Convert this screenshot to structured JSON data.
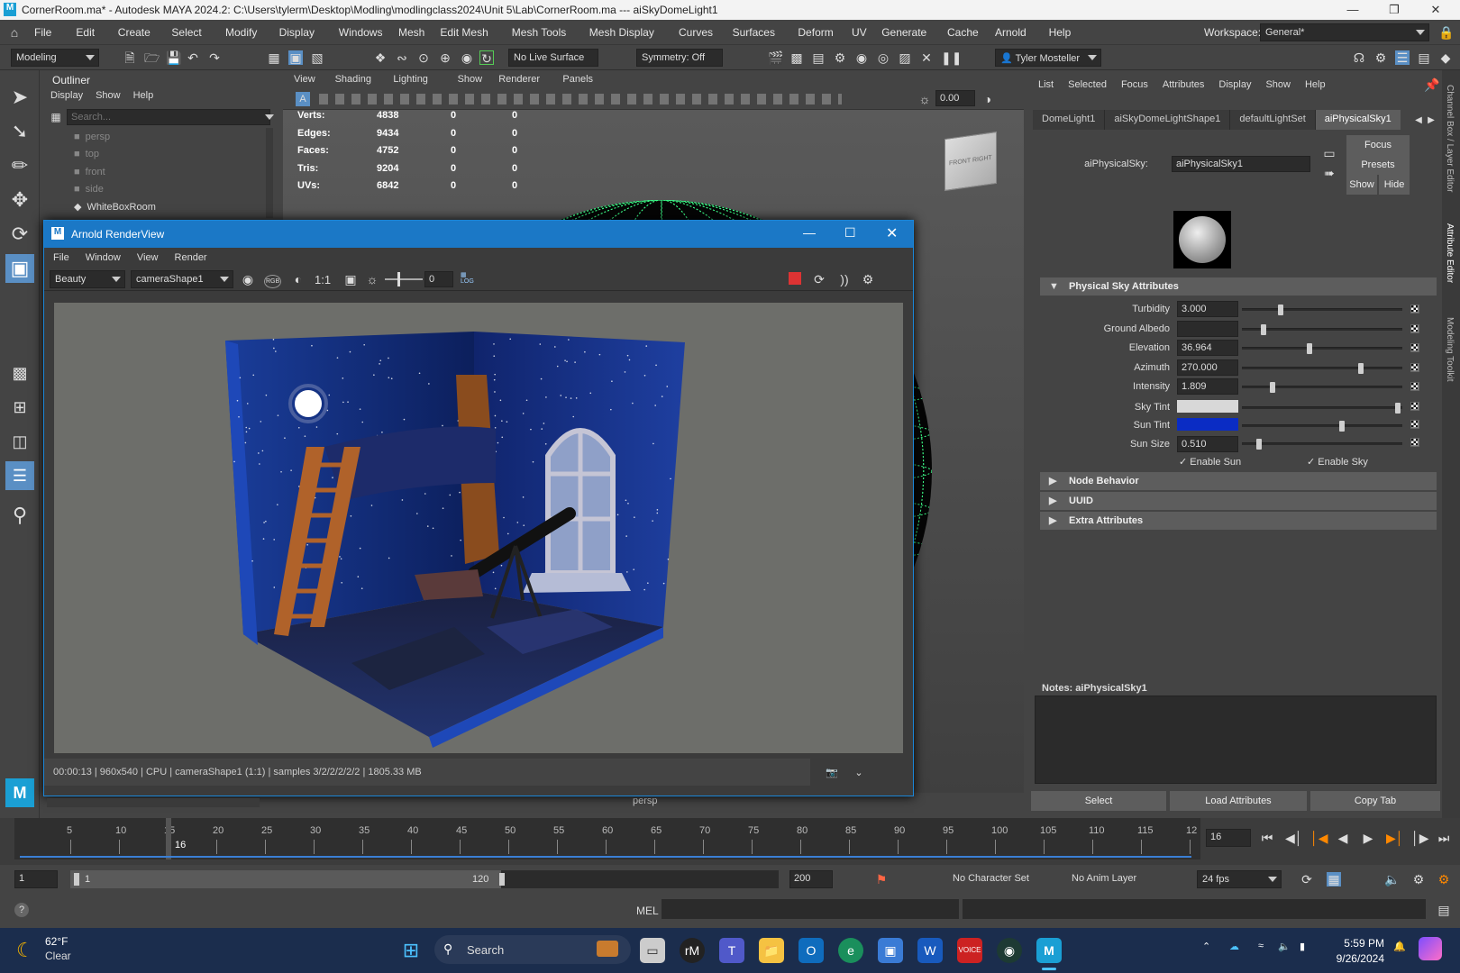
{
  "titlebar": {
    "title": "CornerRoom.ma* - Autodesk MAYA 2024.2: C:\\Users\\tylerm\\Desktop\\Modling\\modlingclass2024\\Unit 5\\Lab\\CornerRoom.ma  ---  aiSkyDomeLight1",
    "logo": "M"
  },
  "menubar": {
    "items": [
      "File",
      "Edit",
      "Create",
      "Select",
      "Modify",
      "Display",
      "Windows",
      "Mesh",
      "Edit Mesh",
      "Mesh Tools",
      "Mesh Display",
      "Curves",
      "Surfaces",
      "Deform",
      "UV",
      "Generate",
      "Cache",
      "Arnold",
      "Help"
    ],
    "workspace_label": "Workspace:",
    "workspace_value": "General*"
  },
  "shelf": {
    "mode": "Modeling",
    "live_surface": "No Live Surface",
    "symmetry": "Symmetry: Off",
    "user": "Tyler Mosteller"
  },
  "outliner": {
    "title": "Outliner",
    "menu": [
      "Display",
      "Show",
      "Help"
    ],
    "search_placeholder": "Search...",
    "items": [
      "persp",
      "top",
      "front",
      "side",
      "WhiteBoxRoom"
    ]
  },
  "viewport": {
    "menu": [
      "View",
      "Shading",
      "Lighting",
      "Show",
      "Renderer",
      "Panels"
    ],
    "value": "0.00",
    "camera_label": "persp",
    "cube_front": "FRONT",
    "cube_right": "RIGHT",
    "hud": [
      [
        "Verts:",
        "4838",
        "0",
        "0"
      ],
      [
        "Edges:",
        "9434",
        "0",
        "0"
      ],
      [
        "Faces:",
        "4752",
        "0",
        "0"
      ],
      [
        "Tris:",
        "9204",
        "0",
        "0"
      ],
      [
        "UVs:",
        "6842",
        "0",
        "0"
      ]
    ]
  },
  "renderview": {
    "title": "Arnold RenderView",
    "menu": [
      "File",
      "Window",
      "View",
      "Render"
    ],
    "aov": "Beauty",
    "camera": "cameraShape1",
    "ratio": "1:1",
    "exposure": "0",
    "rgb": "RGB",
    "log": "LOG",
    "status": "00:00:13 | 960x540 | CPU | cameraShape1 (1:1) | samples 3/2/2/2/2/2 | 1805.33 MB"
  },
  "attr": {
    "menu": [
      "List",
      "Selected",
      "Focus",
      "Attributes",
      "Display",
      "Show",
      "Help"
    ],
    "tabs": [
      "DomeLight1",
      "aiSkyDomeLightShape1",
      "defaultLightSet",
      "aiPhysicalSky1"
    ],
    "node_label": "aiPhysicalSky:",
    "node_value": "aiPhysicalSky1",
    "focus": "Focus",
    "presets": "Presets",
    "show": "Show",
    "hide": "Hide",
    "section": "Physical Sky Attributes",
    "fields": [
      {
        "label": "Turbidity",
        "value": "3.000",
        "slider": 0.23
      },
      {
        "label": "Ground Albedo",
        "value": "",
        "slider": 0.12
      },
      {
        "label": "Elevation",
        "value": "36.964",
        "slider": 0.42
      },
      {
        "label": "Azimuth",
        "value": "270.000",
        "slider": 0.75
      },
      {
        "label": "Intensity",
        "value": "1.809",
        "slider": 0.18
      }
    ],
    "sky_tint_label": "Sky Tint",
    "sun_tint_label": "Sun Tint",
    "sun_size_label": "Sun Size",
    "sun_size_value": "0.510",
    "sky_tint_color": "#d8d8d8",
    "sun_tint_color": "#0a2cc4",
    "enable_sun": "Enable Sun",
    "enable_sky": "Enable Sky",
    "collapsed": [
      "Node Behavior",
      "UUID",
      "Extra Attributes"
    ],
    "notes": "Notes:  aiPhysicalSky1",
    "bottom_buttons": [
      "Select",
      "Load Attributes",
      "Copy Tab"
    ]
  },
  "sidetabs": [
    "Channel Box / Layer Editor",
    "Attribute Editor",
    "Modeling Toolkit"
  ],
  "timeline": {
    "ticks": [
      "5",
      "10",
      "15",
      "20",
      "25",
      "30",
      "35",
      "40",
      "45",
      "50",
      "55",
      "60",
      "65",
      "70",
      "75",
      "80",
      "85",
      "90",
      "95",
      "100",
      "105",
      "110",
      "115",
      "12"
    ],
    "current": "16",
    "frame_field": "16"
  },
  "range": {
    "start": "1",
    "inner_start": "1",
    "inner_end": "120",
    "end": "200",
    "character_set": "No Character Set",
    "anim_layer": "No Anim Layer",
    "fps": "24 fps"
  },
  "cmd": {
    "lang": "MEL"
  },
  "taskbar": {
    "temp": "62°F",
    "weather": "Clear",
    "search": "Search",
    "time": "5:59 PM",
    "date": "9/26/2024"
  }
}
